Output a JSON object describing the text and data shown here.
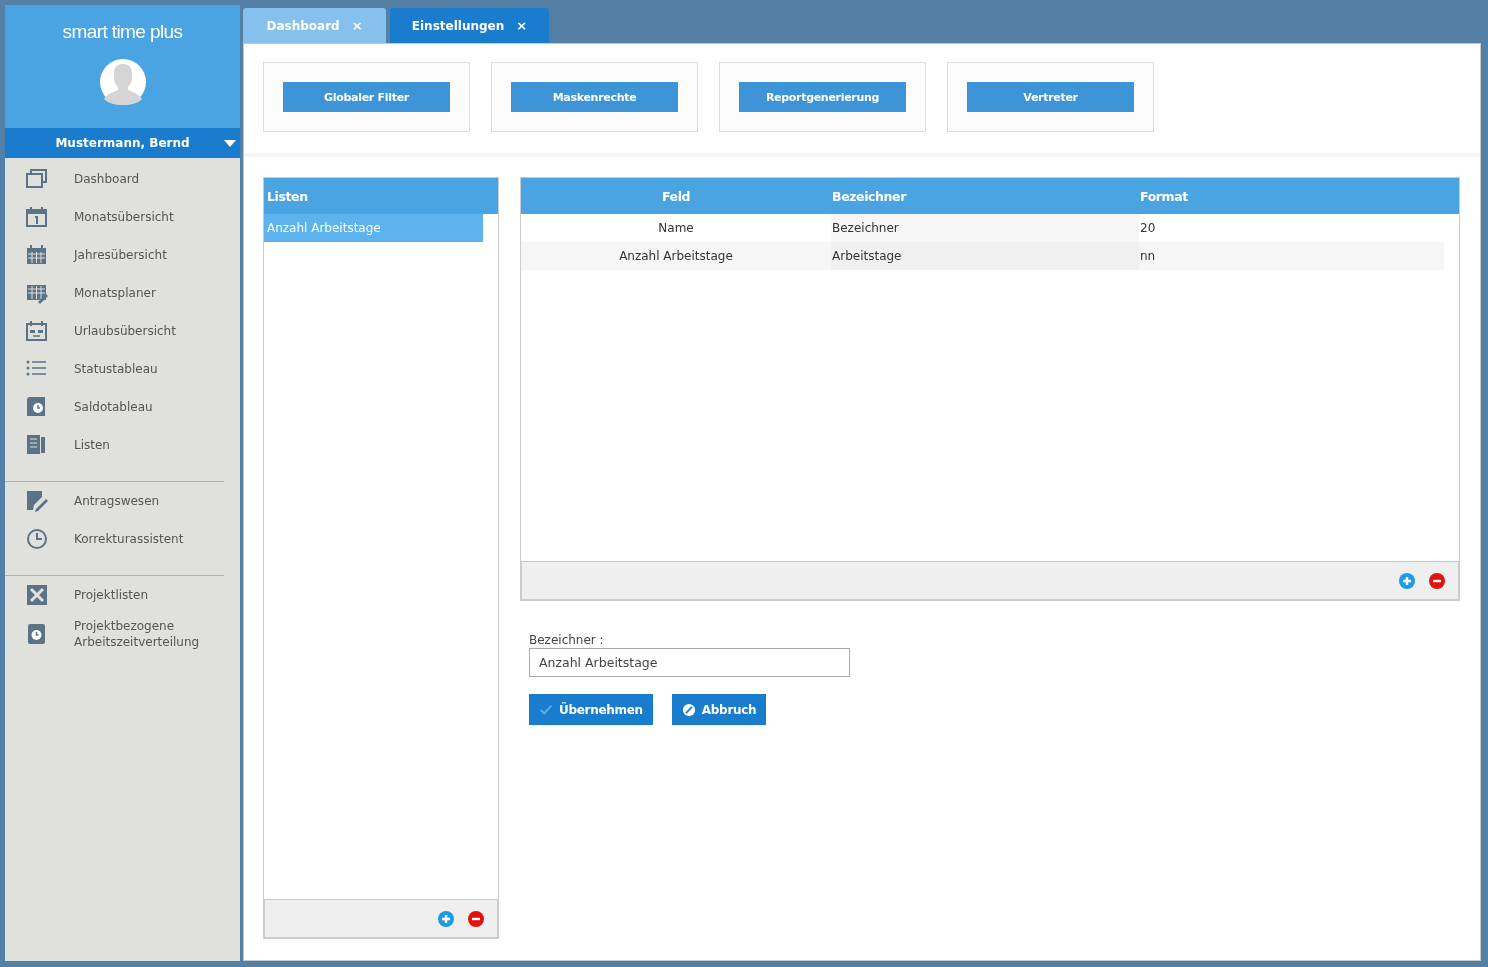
{
  "app": {
    "title": "smart time plus",
    "user": "Mustermann, Bernd"
  },
  "sidebar": {
    "sections": [
      {
        "items": [
          {
            "label": "Dashboard"
          },
          {
            "label": "Monatsübersicht"
          },
          {
            "label": "Jahresübersicht"
          },
          {
            "label": "Monatsplaner"
          },
          {
            "label": "Urlaubsübersicht"
          },
          {
            "label": "Statustableau"
          },
          {
            "label": "Saldotableau"
          },
          {
            "label": "Listen"
          }
        ]
      },
      {
        "items": [
          {
            "label": "Antragswesen"
          },
          {
            "label": "Korrekturassistent"
          }
        ]
      },
      {
        "items": [
          {
            "label": "Projektlisten"
          },
          {
            "label": "Projektbezogene Arbeitszeitverteilung"
          }
        ]
      }
    ]
  },
  "tabs": [
    {
      "label": "Dashboard",
      "close": "×",
      "selected": false
    },
    {
      "label": "Einstellungen",
      "close": "×",
      "selected": true
    }
  ],
  "settings_buttons": [
    "Globaler Filter",
    "Maskenrechte",
    "Reportgenerierung",
    "Vertreter"
  ],
  "lists": {
    "title": "Listen",
    "items": [
      {
        "label": "Anzahl Arbeitstage",
        "selected": true
      }
    ]
  },
  "table": {
    "columns": [
      "Feld",
      "Bezeichner",
      "Format"
    ],
    "rows": [
      [
        "Name",
        "Bezeichner",
        "20"
      ],
      [
        "Anzahl Arbeitstage",
        "Arbeitstage",
        "nn"
      ]
    ]
  },
  "form": {
    "label": "Bezeichner :",
    "value": "Anzahl Arbeitstage",
    "buttons": [
      {
        "kind": "confirm",
        "label": "Übernehmen"
      },
      {
        "kind": "cancel",
        "label": "Abbruch"
      }
    ]
  }
}
